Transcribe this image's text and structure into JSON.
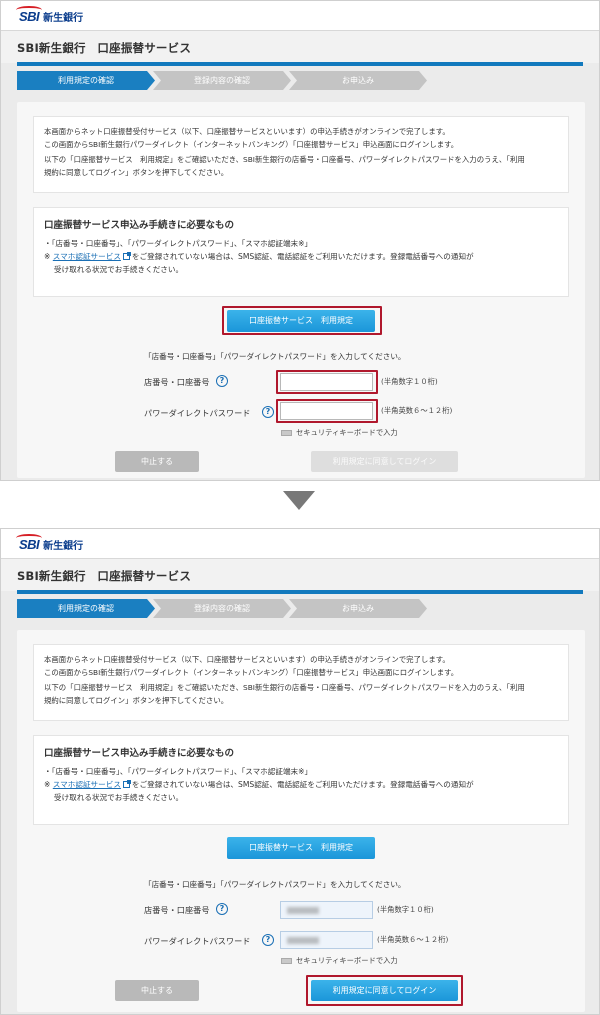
{
  "brand": {
    "logo_mark": "SBI",
    "logo_text": "新生銀行"
  },
  "header": {
    "title": "SBI新生銀行　口座振替サービス"
  },
  "steps": [
    {
      "label": "利用規定の確認"
    },
    {
      "label": "登録内容の確認"
    },
    {
      "label": "お申込み"
    }
  ],
  "colors": {
    "accent": "#1279bd",
    "button_blue": "#1b96d9",
    "highlight_red": "#b0182d",
    "step_active": "#1a7fc1",
    "step_inactive": "#c4c4c4"
  },
  "notice": {
    "line1": "本画面からネット口座振替受付サービス（以下、口座振替サービスといいます）の申込手続きがオンラインで完了します。",
    "line2": "この画面からSBI新生銀行パワーダイレクト（インターネットバンキング）「口座振替サービス」申込画面にログインします。",
    "line3": "以下の「口座振替サービス　利用規定」をご確認いただき、SBI新生銀行の店番号・口座番号、パワーダイレクトパスワードを入力のうえ、「利用",
    "line4": "規約に同意してログイン」ボタンを押下してください。"
  },
  "requirements": {
    "title": "口座振替サービス申込み手続きに必要なもの",
    "bullet": "・「店番号・口座番号」、「パワーダイレクトパスワード」、「スマホ認証端末※」",
    "note_prefix": "※",
    "note_link": "スマホ認証サービス",
    "note_rest": "をご登録されていない場合は、SMS認証、電話認証をご利用いただけます。登録電話番号への通知が",
    "note_line2": "受け取れる状況でお手続きください。"
  },
  "terms_button": "口座振替サービス　利用規定",
  "form": {
    "instruction": "「店番号・口座番号」「パワーダイレクトパスワード」を入力してください。",
    "branch_label": "店番号・口座番号",
    "branch_hint": "(半角数字１０桁)",
    "password_label": "パワーダイレクトパスワード",
    "password_hint": "(半角英数６～１２桁)",
    "help_glyph": "?",
    "keyboard_label": "セキュリティキーボードで入力"
  },
  "buttons": {
    "cancel": "中止する",
    "login": "利用規定に同意してログイン"
  }
}
